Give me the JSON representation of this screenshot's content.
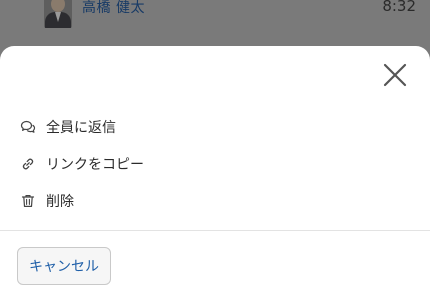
{
  "background_row": {
    "name": "高橋 健太",
    "time": "8:32",
    "avatar_icon": "user-photo"
  },
  "sheet": {
    "close_icon": "close-icon",
    "items": [
      {
        "label": "全員に返信",
        "icon": "speech-bubbles-icon"
      },
      {
        "label": "リンクをコピー",
        "icon": "link-icon"
      },
      {
        "label": "削除",
        "icon": "trash-icon"
      }
    ],
    "cancel_label": "キャンセル"
  },
  "colors": {
    "overlay": "#7a7a7a",
    "link_blue": "#1f5fa8",
    "text": "#2b2b2b"
  }
}
